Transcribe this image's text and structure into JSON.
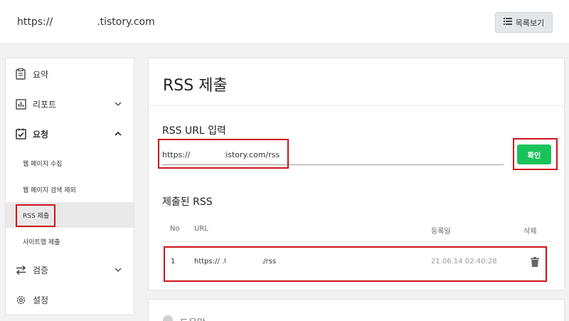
{
  "header": {
    "site_url_prefix": "https://",
    "site_url_suffix": ".tistory.com",
    "list_button_label": "목록보기",
    "list_icon": "list-icon"
  },
  "sidebar": {
    "items": [
      {
        "label": "요약",
        "icon": "summary-icon"
      },
      {
        "label": "리포트",
        "icon": "report-icon",
        "chevron": "chevron-down"
      },
      {
        "label": "요청",
        "icon": "request-check-icon",
        "chevron": "chevron-up",
        "expanded": true
      },
      {
        "label": "검증",
        "icon": "verify-arrows-icon",
        "chevron": "chevron-down"
      },
      {
        "label": "설정",
        "icon": "gear-icon"
      }
    ],
    "sub_items": [
      {
        "label": "웹 페이지 수집"
      },
      {
        "label": "웹 페이지 검색 제외"
      },
      {
        "label": "RSS 제출",
        "selected": true
      },
      {
        "label": "사이트맵 제출"
      }
    ]
  },
  "main": {
    "title": "RSS 제출",
    "input_label": "RSS URL 입력",
    "input_value": "https://            .tistory.com/rss",
    "confirm_button_label": "확인",
    "submitted_title": "제출된 RSS",
    "table": {
      "headers": [
        "No",
        "URL",
        "등록일",
        "삭제"
      ],
      "rows": [
        {
          "no": "1",
          "url": "https://              .tistory.com/rss",
          "date": "21.06.14 02:40:28"
        }
      ]
    },
    "help_label": "도움말"
  },
  "colors": {
    "accent_green": "#19c35a",
    "highlight_red": "#d0121b",
    "selected_bg": "#e9e9e9"
  }
}
